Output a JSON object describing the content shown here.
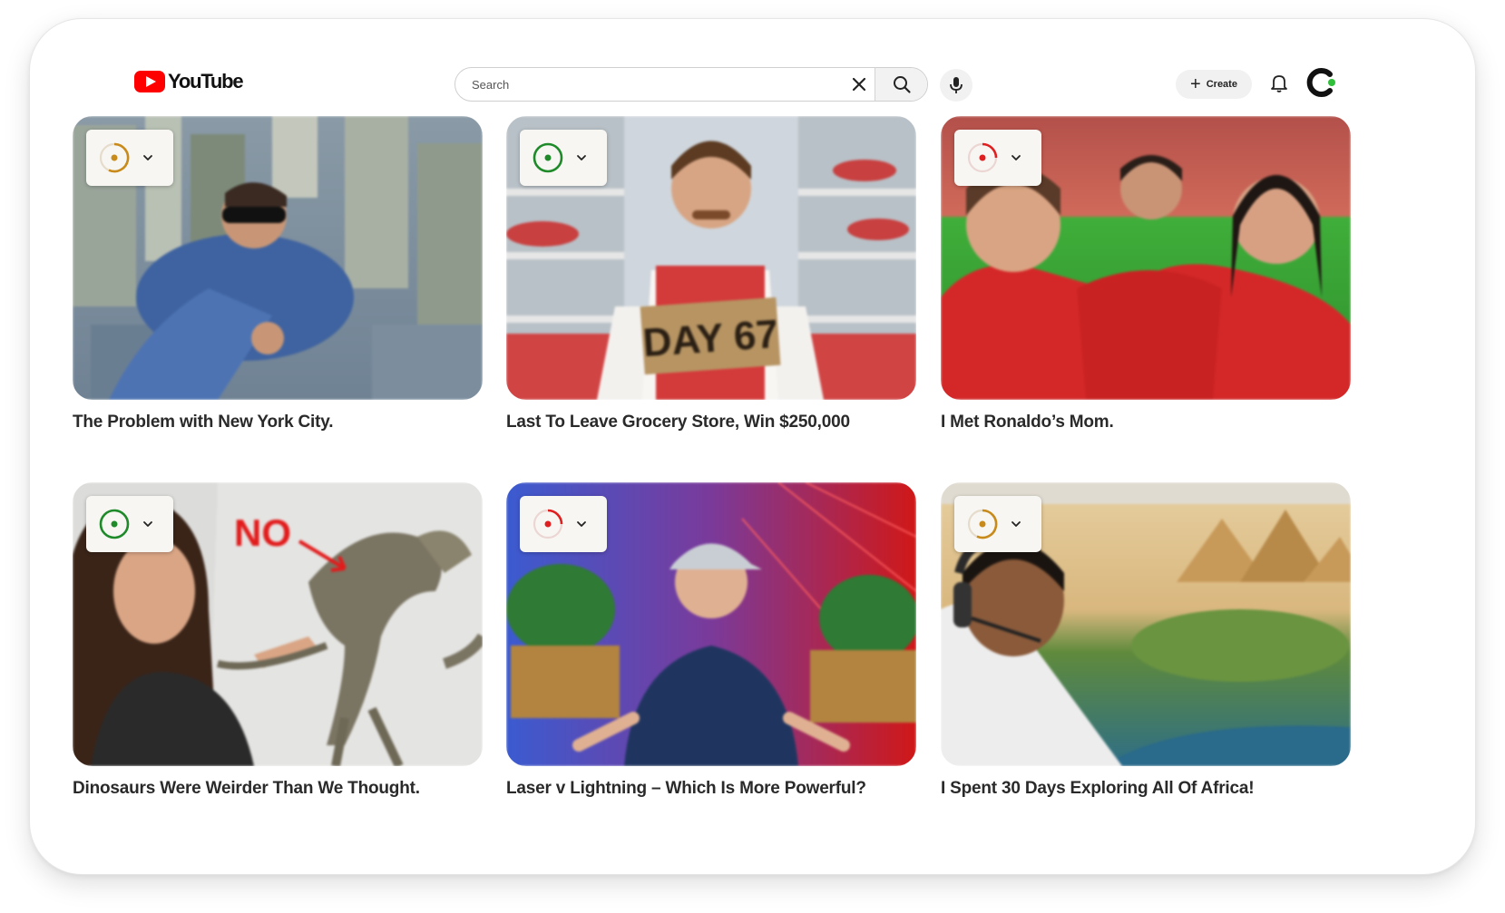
{
  "header": {
    "logo_text": "YouTube",
    "search_placeholder": "Search",
    "create_label": "Create"
  },
  "colors": {
    "brand_red": "#ff0000",
    "rating_green": "#1f8a2a",
    "rating_red": "#e02020",
    "rating_amber": "#c88a1a",
    "avatar_dot": "#2fbf3a"
  },
  "videos": [
    {
      "title": "The Problem with New York City.",
      "rating_status": "amber",
      "rating_icon": "amber-ring-icon"
    },
    {
      "title": "Last To Leave Grocery Store, Win $250,000",
      "rating_status": "green",
      "rating_icon": "green-ring-icon"
    },
    {
      "title": "I Met Ronaldo’s Mom.",
      "rating_status": "red",
      "rating_icon": "red-ring-icon"
    },
    {
      "title": "Dinosaurs Were Weirder Than We Thought.",
      "rating_status": "green",
      "rating_icon": "green-ring-icon"
    },
    {
      "title": "Laser v Lightning – Which Is More Powerful?",
      "rating_status": "red",
      "rating_icon": "red-ring-icon"
    },
    {
      "title": "I Spent 30 Days Exploring All Of Africa!",
      "rating_status": "amber",
      "rating_icon": "amber-ring-icon"
    }
  ],
  "thumbnail_text": {
    "day_sign": "DAY 67",
    "no_label": "NO"
  }
}
